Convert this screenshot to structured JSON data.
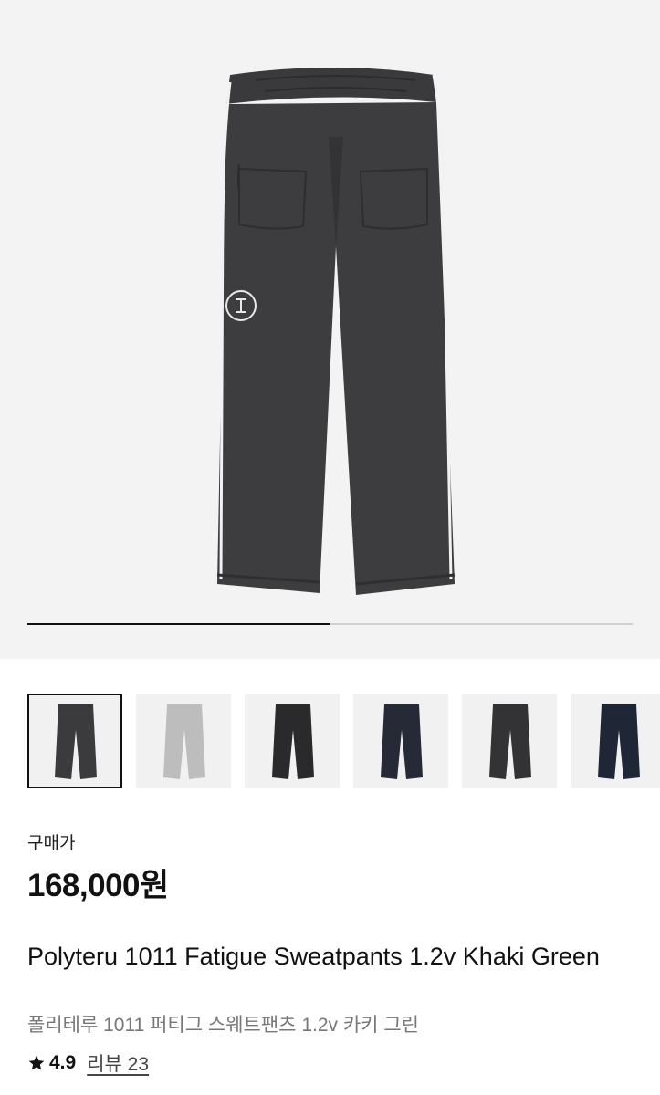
{
  "product": {
    "price_label": "구매가",
    "price": "168,000원",
    "title": "Polyteru 1011 Fatigue Sweatpants 1.2v Khaki Green",
    "subtitle": "폴리테루 1011 퍼티그 스웨트팬츠 1.2v 카키 그린",
    "rating": "4.9",
    "review_label": "리뷰 23"
  },
  "gallery": {
    "progress": 0.5,
    "thumbnails": [
      {
        "name": "thumb-charcoal",
        "color": "#3b3b3d",
        "selected": true
      },
      {
        "name": "thumb-gray",
        "color": "#bdbdbd",
        "selected": false
      },
      {
        "name": "thumb-black",
        "color": "#2a2a2c",
        "selected": false
      },
      {
        "name": "thumb-navy",
        "color": "#262a36",
        "selected": false
      },
      {
        "name": "thumb-dark",
        "color": "#333335",
        "selected": false
      },
      {
        "name": "thumb-dark-navy",
        "color": "#1f2636",
        "selected": false
      }
    ]
  },
  "colors": {
    "pants_main": "#3d3d3f",
    "piping": "#f2f2f2",
    "accent_star": "#111111"
  }
}
